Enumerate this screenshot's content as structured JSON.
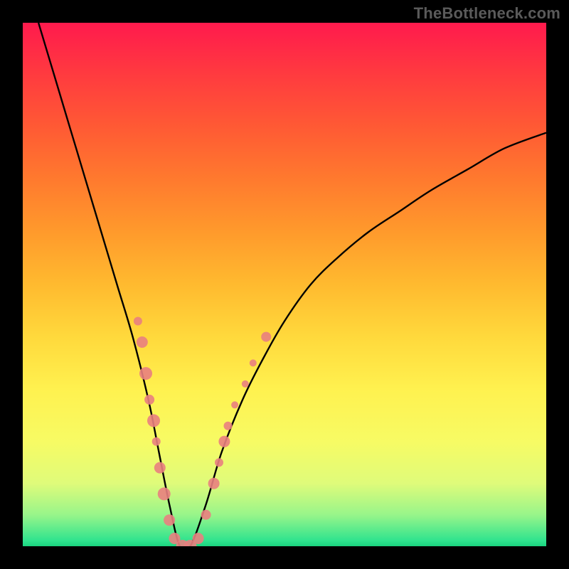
{
  "watermark": "TheBottleneck.com",
  "chart_data": {
    "type": "line",
    "title": "",
    "xlabel": "",
    "ylabel": "",
    "xlim": [
      0,
      100
    ],
    "ylim": [
      0,
      100
    ],
    "grid": false,
    "legend": false,
    "annotations": [],
    "series": [
      {
        "name": "bottleneck-curve",
        "color": "#000000",
        "x": [
          3,
          6,
          9,
          12,
          15,
          18,
          21,
          24,
          26,
          28,
          30,
          32,
          35,
          38,
          42,
          46,
          50,
          55,
          60,
          66,
          72,
          78,
          85,
          92,
          100
        ],
        "y": [
          100,
          90,
          80,
          70,
          60,
          50,
          40,
          28,
          18,
          8,
          0,
          0,
          8,
          18,
          28,
          36,
          43,
          50,
          55,
          60,
          64,
          68,
          72,
          76,
          79
        ]
      }
    ],
    "scatter_overlay": {
      "name": "sample-points",
      "color": "#e98080",
      "radius_range": [
        4,
        10
      ],
      "points": [
        {
          "x": 22.0,
          "y": 43.0,
          "r": 6
        },
        {
          "x": 22.8,
          "y": 39.0,
          "r": 8
        },
        {
          "x": 23.5,
          "y": 33.0,
          "r": 9
        },
        {
          "x": 24.2,
          "y": 28.0,
          "r": 7
        },
        {
          "x": 25.0,
          "y": 24.0,
          "r": 9
        },
        {
          "x": 25.5,
          "y": 20.0,
          "r": 6
        },
        {
          "x": 26.2,
          "y": 15.0,
          "r": 8
        },
        {
          "x": 27.0,
          "y": 10.0,
          "r": 9
        },
        {
          "x": 28.0,
          "y": 5.0,
          "r": 8
        },
        {
          "x": 29.0,
          "y": 1.5,
          "r": 8
        },
        {
          "x": 30.5,
          "y": 0.0,
          "r": 9
        },
        {
          "x": 32.0,
          "y": 0.0,
          "r": 9
        },
        {
          "x": 33.5,
          "y": 1.5,
          "r": 8
        },
        {
          "x": 35.0,
          "y": 6.0,
          "r": 7
        },
        {
          "x": 36.5,
          "y": 12.0,
          "r": 8
        },
        {
          "x": 37.5,
          "y": 16.0,
          "r": 6
        },
        {
          "x": 38.5,
          "y": 20.0,
          "r": 8
        },
        {
          "x": 39.2,
          "y": 23.0,
          "r": 6
        },
        {
          "x": 40.5,
          "y": 27.0,
          "r": 5
        },
        {
          "x": 42.5,
          "y": 31.0,
          "r": 5
        },
        {
          "x": 44.0,
          "y": 35.0,
          "r": 5
        },
        {
          "x": 46.5,
          "y": 40.0,
          "r": 7
        }
      ]
    },
    "background_gradient_stops": [
      {
        "pos": 0.0,
        "color": "#ff1a4d"
      },
      {
        "pos": 0.5,
        "color": "#ffba2f"
      },
      {
        "pos": 0.8,
        "color": "#f7fb64"
      },
      {
        "pos": 0.99,
        "color": "#2ee38e"
      },
      {
        "pos": 1.0,
        "color": "#1ad47e"
      }
    ]
  }
}
